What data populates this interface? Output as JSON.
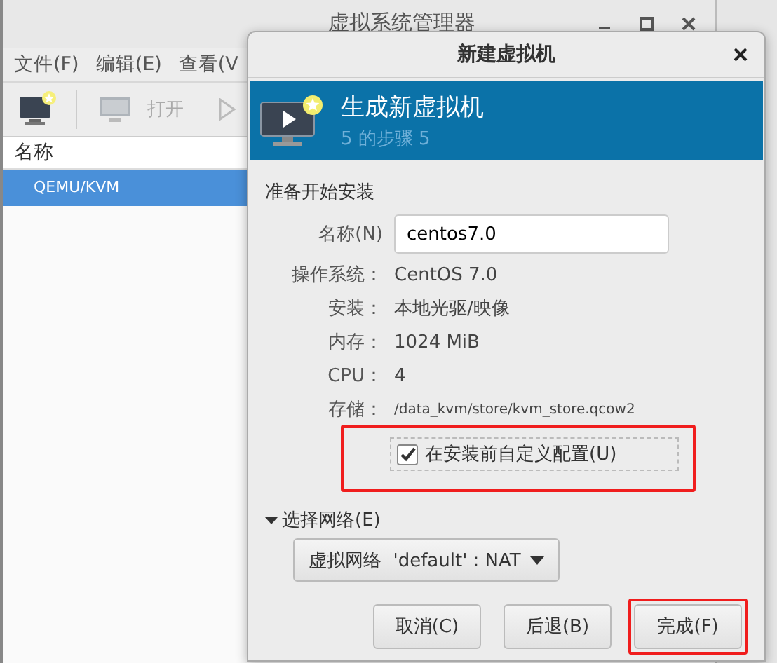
{
  "main_window": {
    "title": "虚拟系统管理器",
    "menu": [
      "文件(F)",
      "编辑(E)",
      "查看(V"
    ],
    "toolbar": [
      {
        "kind": "new"
      },
      {
        "kind": "open",
        "label": "打开"
      },
      {
        "kind": "run"
      }
    ],
    "list": {
      "header": "名称",
      "rows": [
        {
          "label": "QEMU/KVM",
          "selected": true
        }
      ]
    }
  },
  "dialog": {
    "title": "新建虚拟机",
    "banner": {
      "title": "生成新虚拟机",
      "subtitle": "5 的步骤 5"
    },
    "heading": "准备开始安装",
    "name_field": {
      "label": "名称(N)",
      "value": "centos7.0"
    },
    "details": [
      {
        "kind": "text",
        "label": "操作系统：",
        "value": "CentOS 7.0"
      },
      {
        "kind": "text",
        "label": "安装：",
        "value": "本地光驱/映像"
      },
      {
        "kind": "text",
        "label": "内存：",
        "value": "1024 MiB"
      },
      {
        "kind": "text",
        "label": "CPU：",
        "value": "4"
      },
      {
        "kind": "path",
        "label": "存储：",
        "value": "/data_kvm/store/kvm_store.qcow2"
      }
    ],
    "customize": {
      "label": "在安装前自定义配置(U)",
      "checked": true,
      "highlighted": true
    },
    "network": {
      "label": "选择网络(E)",
      "expanded": true,
      "dropdown": "虚拟网络  'default' : NAT"
    },
    "buttons": [
      {
        "label": "取消(C)",
        "highlighted": false
      },
      {
        "label": "后退(B)",
        "highlighted": false
      },
      {
        "label": "完成(F)",
        "highlighted": true
      }
    ]
  }
}
